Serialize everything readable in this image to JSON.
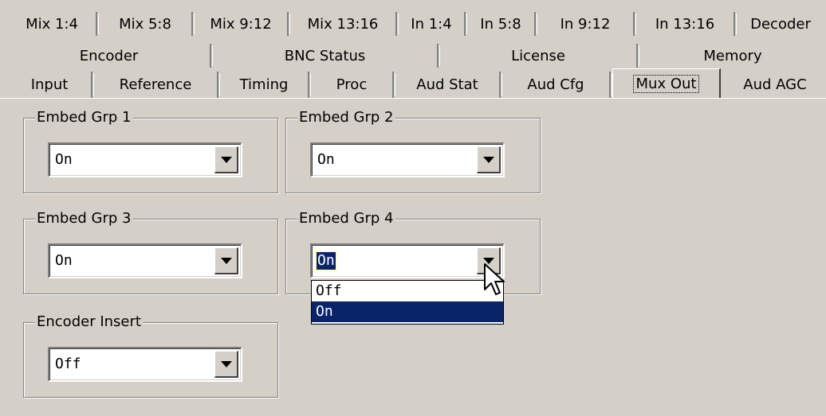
{
  "tabs": {
    "row1": [
      "Mix 1:4",
      "Mix 5:8",
      "Mix 9:12",
      "Mix 13:16",
      "In 1:4",
      "In 5:8",
      "In 9:12",
      "In 13:16",
      "Decoder"
    ],
    "row2": [
      "Encoder",
      "BNC Status",
      "License",
      "Memory"
    ],
    "row3": [
      "Input",
      "Reference",
      "Timing",
      "Proc",
      "Aud Stat",
      "Aud Cfg",
      "Mux Out",
      "Aud AGC"
    ],
    "active": "Mux Out"
  },
  "groups": {
    "embed_grp_1": {
      "label": "Embed Grp 1",
      "value": "On"
    },
    "embed_grp_2": {
      "label": "Embed Grp 2",
      "value": "On"
    },
    "embed_grp_3": {
      "label": "Embed Grp 3",
      "value": "On"
    },
    "embed_grp_4": {
      "label": "Embed Grp 4",
      "value": "On",
      "open": true
    },
    "encoder_insert": {
      "label": "Encoder Insert",
      "value": "Off"
    }
  },
  "dropdown_options": [
    "Off",
    "On"
  ],
  "dropdown_selected": "On",
  "colors": {
    "face": "#d4d0c8",
    "highlight": "#0a246a",
    "highlight_text": "#ffffff"
  },
  "icons": {
    "combo_button": "chevron-down-icon",
    "cursor": "mouse-pointer-icon"
  }
}
